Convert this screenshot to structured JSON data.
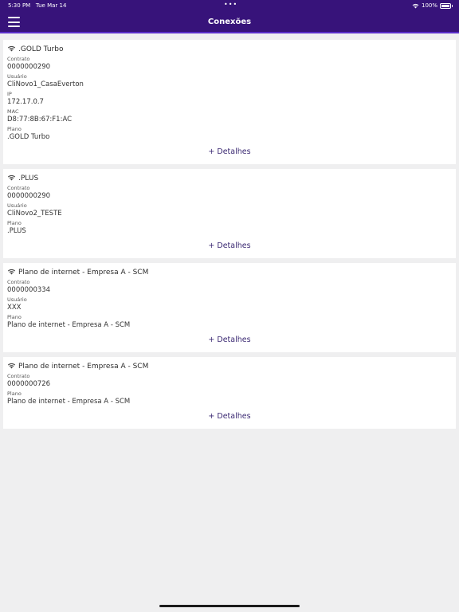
{
  "status_bar": {
    "time": "5:30 PM",
    "date": "Tue Mar 14",
    "battery": "100%"
  },
  "header": {
    "title": "Conexões"
  },
  "connections": [
    {
      "title": ".GOLD Turbo",
      "fields": [
        {
          "label": "Contrato",
          "value": "0000000290"
        },
        {
          "label": "Usuário",
          "value": "CliNovo1_CasaEverton"
        },
        {
          "label": "IP",
          "value": "172.17.0.7"
        },
        {
          "label": "MAC",
          "value": "D8:77:8B:67:F1:AC"
        },
        {
          "label": "Plano",
          "value": ".GOLD Turbo"
        }
      ],
      "details_label": "+ Detalhes"
    },
    {
      "title": ".PLUS",
      "fields": [
        {
          "label": "Contrato",
          "value": "0000000290"
        },
        {
          "label": "Usuário",
          "value": "CliNovo2_TESTE"
        },
        {
          "label": "Plano",
          "value": ".PLUS"
        }
      ],
      "details_label": "+ Detalhes"
    },
    {
      "title": "Plano de internet - Empresa A - SCM",
      "fields": [
        {
          "label": "Contrato",
          "value": "0000000334"
        },
        {
          "label": "Usuário",
          "value": "XXX"
        },
        {
          "label": "Plano",
          "value": "Plano de internet - Empresa A - SCM"
        }
      ],
      "details_label": "+ Detalhes"
    },
    {
      "title": "Plano de internet - Empresa A - SCM",
      "fields": [
        {
          "label": "Contrato",
          "value": "0000000726"
        },
        {
          "label": "Plano",
          "value": "Plano de internet - Empresa A - SCM"
        }
      ],
      "details_label": "+ Detalhes"
    }
  ],
  "icons": {
    "menu": "hamburger-menu-icon",
    "wifi": "wifi-icon",
    "battery": "battery-icon"
  },
  "colors": {
    "header_bg": "#37137a",
    "link": "#3a2872",
    "background": "#efeff0"
  }
}
